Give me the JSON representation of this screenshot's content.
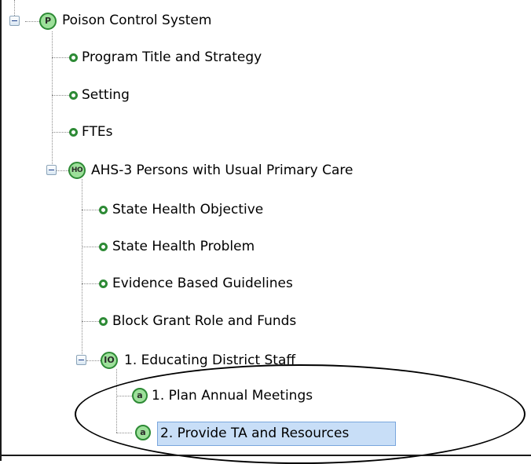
{
  "tree": {
    "root": {
      "badge": "P",
      "label": "Poison Control System"
    },
    "root_children": [
      {
        "label": "Program Title and Strategy"
      },
      {
        "label": "Setting"
      },
      {
        "label": "FTEs"
      }
    ],
    "ho": {
      "badge": "HO",
      "label": "AHS-3 Persons with Usual Primary Care"
    },
    "ho_children": [
      {
        "label": "State Health Objective"
      },
      {
        "label": "State Health Problem"
      },
      {
        "label": "Evidence Based Guidelines"
      },
      {
        "label": "Block Grant Role and Funds"
      }
    ],
    "io": {
      "badge": "IO",
      "label": "1. Educating District Staff"
    },
    "activities": [
      {
        "badge": "a",
        "label": "1. Plan Annual Meetings"
      },
      {
        "badge": "a",
        "label": "2. Provide TA and Resources",
        "selected": true
      }
    ]
  },
  "colors": {
    "badge_fill": "#9de09a",
    "badge_border": "#2d8a35",
    "selection_fill": "#c8def7",
    "selection_border": "#7aa6dd"
  }
}
